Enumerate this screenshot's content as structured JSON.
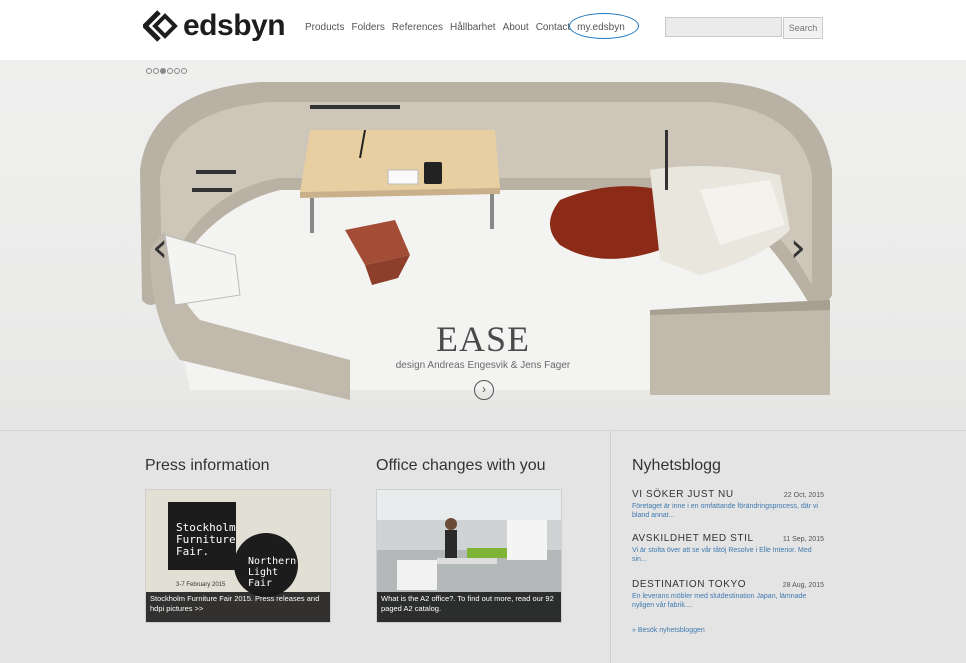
{
  "header": {
    "brand": "edsbyn",
    "nav": [
      "Products",
      "Folders",
      "References",
      "Hållbarhet",
      "About",
      "Contact",
      "my.edsbyn"
    ],
    "search_placeholder": "",
    "search_button": "Search"
  },
  "hero": {
    "slide_count": 6,
    "active_slide": 3,
    "title": "EASE",
    "subtitle": "design Andreas Engesvik & Jens Fager",
    "prev_icon": "chevron-left-icon",
    "next_icon": "chevron-right-icon",
    "more_icon": "circle-arrow-right-icon"
  },
  "press": {
    "title": "Press information",
    "image_text": [
      "Stockholm",
      "Furniture",
      "Fair.",
      "Northern",
      "Light",
      "Fair",
      "3-7 February 2015"
    ],
    "caption": "Stockholm Furniture Fair 2015. Press releases and hdpi pictures >>"
  },
  "office": {
    "title": "Office changes with you",
    "caption": "What is the A2 office?. To find out more, read our 92 paged A2 catalog."
  },
  "blog": {
    "title": "Nyhetsblogg",
    "items": [
      {
        "title": "VI SÖKER JUST NU",
        "date": "22 Oct, 2015",
        "text": "Företaget är inne i en omfattande förändringsprocess, där vi bland annat..."
      },
      {
        "title": "AVSKILDHET MED STIL",
        "date": "11 Sep, 2015",
        "text": "Vi är stolta över att se vår tåtöj Resolve i Elle Interior. Med sin..."
      },
      {
        "title": "DESTINATION TOKYO",
        "date": "28 Aug, 2015",
        "text": "En leverans möbler med slutdestination Japan, lämnade nyligen vår fabrik...."
      }
    ],
    "more_link": "» Besök nyhetsbloggen"
  },
  "colors": {
    "accent_circle": "#1f7ac2",
    "link": "#3f7ab0",
    "hero_rug": "#8b2a17"
  }
}
